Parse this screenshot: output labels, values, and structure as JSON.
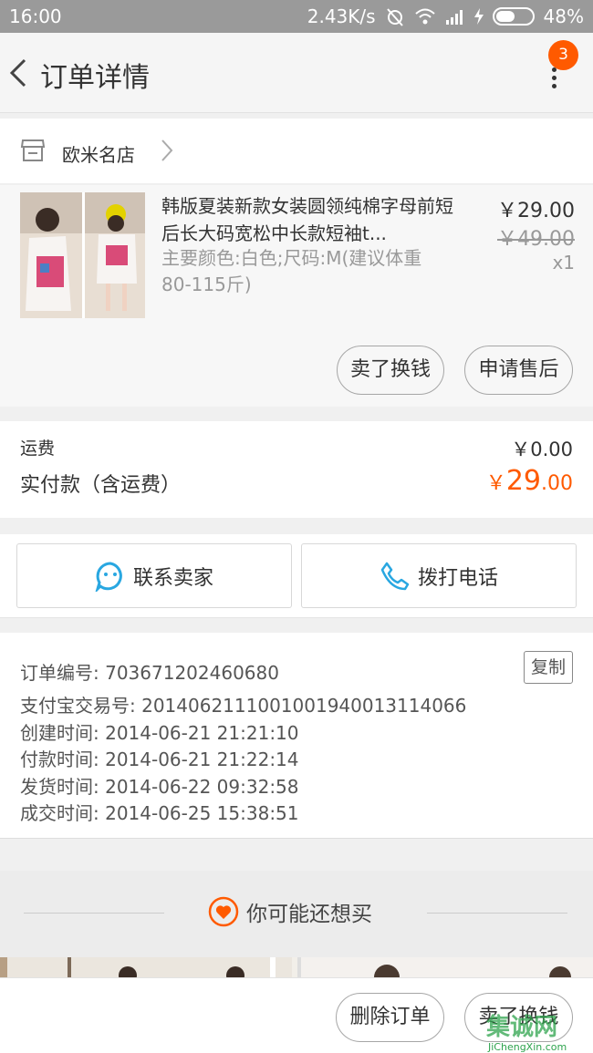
{
  "status_bar": {
    "time": "16:00",
    "speed": "2.43K/s",
    "battery": "48%",
    "battery_level": 0.48
  },
  "header": {
    "title": "订单详情",
    "badge_count": "3"
  },
  "shop": {
    "name": "欧米名店"
  },
  "item": {
    "name": "韩版夏装新款女装圆领纯棉字母前短后长大码宽松中长款短袖t...",
    "sku": "主要颜色:白色;尺码:M(建议体重80-115斤)",
    "price": "￥29.00",
    "original_price": "￥49.00",
    "quantity": "x1",
    "btn_sell": "卖了换钱",
    "btn_aftersale": "申请售后"
  },
  "totals": {
    "shipping_label": "运费",
    "shipping_value": "￥0.00",
    "paid_label": "实付款（含运费）",
    "paid_symbol": "￥",
    "paid_int": "29",
    "paid_dec": ".00"
  },
  "contact": {
    "seller": "联系卖家",
    "call": "拨打电话"
  },
  "order_info": {
    "order_no": "订单编号: 703671202460680",
    "copy": "复制",
    "alipay_no": "支付宝交易号: 2014062111001001940013114066",
    "created": "创建时间: 2014-06-21 21:21:10",
    "paid": "付款时间: 2014-06-21 21:22:14",
    "shipped": "发货时间: 2014-06-22 09:32:58",
    "completed": "成交时间: 2014-06-25 15:38:51"
  },
  "recommend": {
    "title": "你可能还想买"
  },
  "bottom": {
    "delete": "删除订单",
    "sell": "卖了换钱"
  },
  "watermark": {
    "cn": "集诚网",
    "en": "JiChengXin.com"
  },
  "colors": {
    "accent": "#ff5a00",
    "icon_blue": "#29a7e1",
    "watermark": "#2ea34d"
  }
}
